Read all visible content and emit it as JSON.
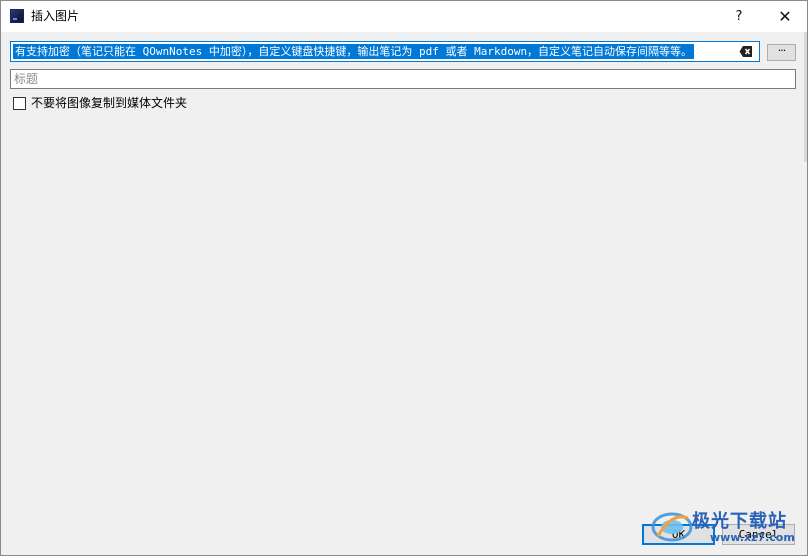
{
  "window": {
    "title": "插入图片",
    "help_label": "?",
    "close_label": "✕"
  },
  "path_field": {
    "value": "有支持加密（笔记只能在 QOwnNotes 中加密），自定义键盘快捷键，输出笔记为 pdf 或者 Markdown，自定义笔记自动保存间隔等等。",
    "clear_icon": "backspace-clear-icon"
  },
  "browse_button": {
    "label": "···"
  },
  "title_field": {
    "placeholder": "标题",
    "value": ""
  },
  "copy_checkbox": {
    "label": "不要将图像复制到媒体文件夹",
    "checked": false
  },
  "buttons": {
    "ok": "OK",
    "cancel": "Cancel"
  },
  "watermark": {
    "name": "极光下载站",
    "url": "www.xz7.com"
  },
  "colors": {
    "accent": "#0078d7",
    "dialog_bg": "#f0f0f0",
    "watermark": "#2a62b8"
  }
}
